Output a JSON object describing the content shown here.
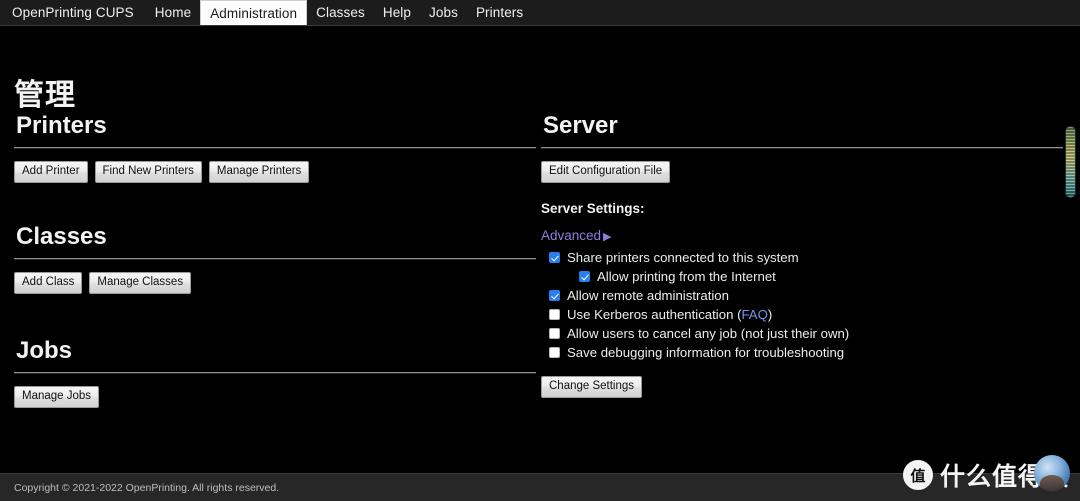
{
  "nav": {
    "brand": "OpenPrinting CUPS",
    "items": [
      {
        "label": "Home",
        "active": false
      },
      {
        "label": "Administration",
        "active": true
      },
      {
        "label": "Classes",
        "active": false
      },
      {
        "label": "Help",
        "active": false
      },
      {
        "label": "Jobs",
        "active": false
      },
      {
        "label": "Printers",
        "active": false
      }
    ]
  },
  "page": {
    "title": "管理"
  },
  "left": {
    "printers": {
      "heading": "Printers",
      "buttons": [
        "Add Printer",
        "Find New Printers",
        "Manage Printers"
      ]
    },
    "classes": {
      "heading": "Classes",
      "buttons": [
        "Add Class",
        "Manage Classes"
      ]
    },
    "jobs": {
      "heading": "Jobs",
      "buttons": [
        "Manage Jobs"
      ]
    }
  },
  "right": {
    "server": {
      "heading": "Server",
      "edit_config_button": "Edit Configuration File",
      "settings_label": "Server Settings:",
      "advanced_link": "Advanced",
      "advanced_arrow": "▶",
      "settings": [
        {
          "label": "Share printers connected to this system",
          "checked": true,
          "indent": false,
          "link": null
        },
        {
          "label": "Allow printing from the Internet",
          "checked": true,
          "indent": true,
          "link": null
        },
        {
          "label": "Allow remote administration",
          "checked": true,
          "indent": false,
          "link": null
        },
        {
          "label": "Use Kerberos authentication (",
          "checked": false,
          "indent": false,
          "link": "FAQ",
          "suffix": ")"
        },
        {
          "label": "Allow users to cancel any job (not just their own)",
          "checked": false,
          "indent": false,
          "link": null
        },
        {
          "label": "Save debugging information for troubleshooting",
          "checked": false,
          "indent": false,
          "link": null
        }
      ],
      "change_settings_button": "Change Settings"
    }
  },
  "footer": {
    "copyright": "Copyright © 2021-2022 OpenPrinting. All rights reserved."
  },
  "watermark": {
    "badge": "值",
    "text": "什么值得买"
  },
  "colors": {
    "page_bg": "#000000",
    "nav_bg": "#1c1c1c",
    "active_tab_bg": "#fdfdfd",
    "text": "#e8e8e8",
    "rule": "#8f8f8f",
    "checkbox_checked": "#2a7ff0",
    "link_visited": "#8a7ee0",
    "link": "#7f8fe8",
    "footer_bg": "#272727"
  }
}
